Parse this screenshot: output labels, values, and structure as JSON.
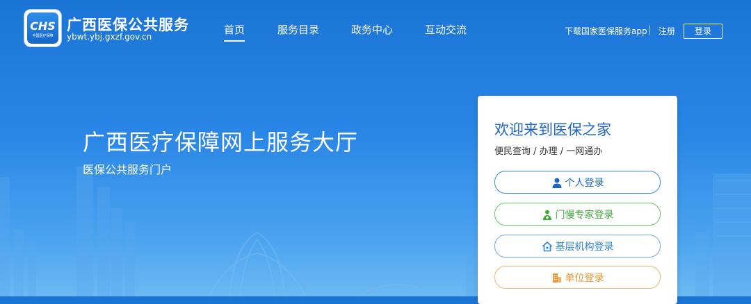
{
  "header": {
    "logo_text": "CHS",
    "logo_subtext": "中国医疗保障",
    "site_name": "广西医保公共服务",
    "site_url": "ybwt.ybj.gxzf.gov.cn"
  },
  "nav": {
    "items": [
      {
        "label": "首页",
        "active": true
      },
      {
        "label": "服务目录",
        "active": false
      },
      {
        "label": "政务中心",
        "active": false
      },
      {
        "label": "互动交流",
        "active": false
      }
    ]
  },
  "top_right": {
    "download_app": "下载国家医保服务app",
    "register": "注册",
    "login": "登录"
  },
  "hero": {
    "title": "广西医疗保障网上服务大厅",
    "subtitle": "医保公共服务门户"
  },
  "login_card": {
    "title": "欢迎来到医保之家",
    "subtitle": "便民查询 / 办理 / 一网通办",
    "buttons": [
      {
        "label": "个人登录",
        "icon": "person-icon",
        "color": "#1e64c4"
      },
      {
        "label": "门慢专家登录",
        "icon": "doctor-icon",
        "color": "#3eab3a"
      },
      {
        "label": "基层机构登录",
        "icon": "house-icon",
        "color": "#2f83dc"
      },
      {
        "label": "单位登录",
        "icon": "building-icon",
        "color": "#e69632"
      }
    ]
  },
  "colors": {
    "background": "#2a86e6",
    "accent": "#1f66c8"
  }
}
